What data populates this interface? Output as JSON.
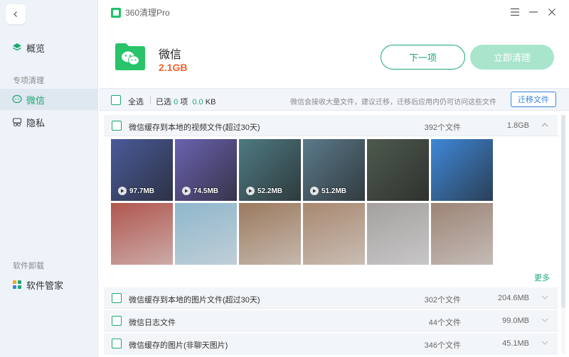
{
  "app": {
    "title": "360清理Pro"
  },
  "sidebar": {
    "overview": "概览",
    "group1": "专项清理",
    "wechat": "微信",
    "privacy": "隐私",
    "group2": "软件卸载",
    "software": "软件管家"
  },
  "header": {
    "name": "微信",
    "size": "2.1GB",
    "next_label": "下一项",
    "clean_label": "立即清理"
  },
  "select_bar": {
    "select_all": "全选",
    "selected_prefix": "已选",
    "selected_count": "0",
    "selected_unit": "项",
    "selected_size": "0.0",
    "selected_size_unit": "KB",
    "hint": "微信会接收大量文件，建议迁移，迁移后应用内仍可访问这些文件",
    "move_label": "迁移文件"
  },
  "categories": [
    {
      "name": "微信缓存到本地的视频文件(超过30天)",
      "count": "392个文件",
      "size": "1.8GB"
    },
    {
      "name": "微信缓存到本地的图片文件(超过30天)",
      "count": "302个文件",
      "size": "204.6MB"
    },
    {
      "name": "微信日志文件",
      "count": "44个文件",
      "size": "99.0MB"
    },
    {
      "name": "微信缓存的图片(非聊天图片)",
      "count": "346个文件",
      "size": "45.1MB"
    }
  ],
  "videos": [
    {
      "size": "97.7MB",
      "color": "#4a5a9a"
    },
    {
      "size": "74.5MB",
      "color": "#6a62b0"
    },
    {
      "size": "52.2MB",
      "color": "#4e7a82"
    },
    {
      "size": "51.2MB",
      "color": "#5b7a8a"
    },
    {
      "size": "",
      "color": "#4e5a4e"
    },
    {
      "size": "",
      "color": "#3f88d8"
    }
  ],
  "images": [
    {
      "color": "#b0564e"
    },
    {
      "color": "#8fb7cc"
    },
    {
      "color": "#9c7a5e"
    },
    {
      "color": "#a88870"
    },
    {
      "color": "#a4a0a0"
    },
    {
      "color": "#9c8476"
    }
  ],
  "more_label": "更多",
  "colors": {
    "accent": "#1aa871",
    "size_orange": "#f0622c",
    "link_blue": "#3b86d8"
  }
}
